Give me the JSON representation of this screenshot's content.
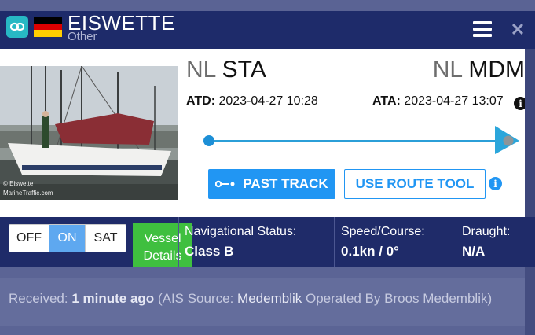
{
  "header": {
    "vessel_name": "EISWETTE",
    "vessel_type": "Other",
    "flag_colors": [
      "#000000",
      "#dd0000",
      "#ffce00"
    ],
    "link_icon": "link-icon",
    "menu_icon": "hamburger-menu-icon",
    "close_icon": "close-icon",
    "close_glyph": "✕"
  },
  "route": {
    "from_country": "NL",
    "from_port": "STA",
    "to_country": "NL",
    "to_port": "MDM",
    "atd_label": "ATD:",
    "atd_value": "2023-04-27 10:28",
    "ata_label": "ATA:",
    "ata_value": "2023-04-27 13:07",
    "info_glyph": "i",
    "progress_fraction": 1.0
  },
  "photo": {
    "watermark_line1": "© Eiswette",
    "watermark_line2": "MarineTraffic.com"
  },
  "buttons": {
    "past_track": "PAST TRACK",
    "route_tool": "USE ROUTE TOOL",
    "vessel_details": "Vessel Details"
  },
  "map_toggle": {
    "options": [
      "OFF",
      "ON",
      "SAT"
    ],
    "selected": "ON"
  },
  "stats": {
    "nav_status_label": "Navigational Status:",
    "nav_status_value": "Class B",
    "speed_course_label": "Speed/Course:",
    "speed_course_value": "0.1kn / 0°",
    "draught_label": "Draught:",
    "draught_value": "N/A"
  },
  "footer": {
    "received_label": "Received:",
    "received_value": "1 minute ago",
    "source_prefix": "(AIS Source:",
    "source_link": "Medemblik",
    "source_suffix": "Operated By Broos Medemblik)"
  },
  "colors": {
    "accent": "#2196f3",
    "vessel_details_green": "#3fbf3f",
    "header_bg": "#1e2b6a"
  }
}
